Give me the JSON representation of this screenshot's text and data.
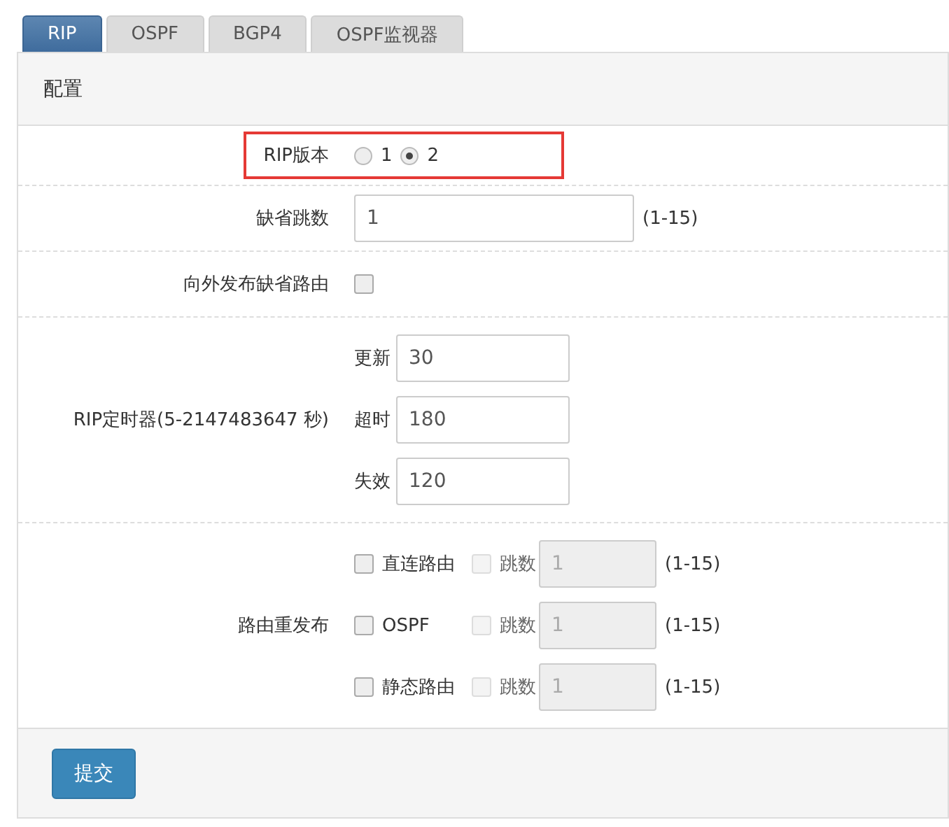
{
  "tabs": [
    {
      "label": "RIP",
      "selected": true
    },
    {
      "label": "OSPF",
      "selected": false
    },
    {
      "label": "BGP4",
      "selected": false
    },
    {
      "label": "OSPF监视器",
      "selected": false
    }
  ],
  "panel": {
    "title": "配置",
    "rip_version": {
      "label": "RIP版本",
      "highlighted": true,
      "options": [
        {
          "label": "1",
          "selected": false
        },
        {
          "label": "2",
          "selected": true
        }
      ]
    },
    "default_hops": {
      "label": "缺省跳数",
      "value": "1",
      "range": "(1-15)"
    },
    "advertise_default": {
      "label": "向外发布缺省路由",
      "checked": false
    },
    "timers": {
      "label": "RIP定时器(5-2147483647 秒)",
      "fields": [
        {
          "label": "更新",
          "value": "30"
        },
        {
          "label": "超时",
          "value": "180"
        },
        {
          "label": "失效",
          "value": "120"
        }
      ]
    },
    "redistribution": {
      "label": "路由重发布",
      "items": [
        {
          "label": "直连路由",
          "checked": false,
          "hops_label": "跳数",
          "hops_checked": false,
          "hops_disabled": true,
          "hops_value": "1",
          "range": "(1-15)"
        },
        {
          "label": "OSPF",
          "checked": false,
          "hops_label": "跳数",
          "hops_checked": false,
          "hops_disabled": true,
          "hops_value": "1",
          "range": "(1-15)"
        },
        {
          "label": "静态路由",
          "checked": false,
          "hops_label": "跳数",
          "hops_checked": false,
          "hops_disabled": true,
          "hops_value": "1",
          "range": "(1-15)"
        }
      ]
    },
    "submit": "提交"
  }
}
